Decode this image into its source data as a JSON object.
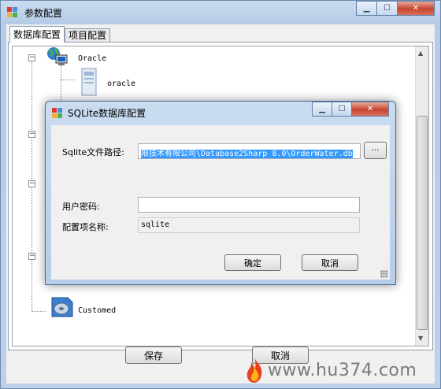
{
  "main_window": {
    "title": "参数配置",
    "tabs": [
      {
        "label": "数据库配置",
        "active": true
      },
      {
        "label": "项目配置",
        "active": false
      }
    ],
    "tree": {
      "nodes": [
        {
          "label": "Oracle",
          "icon": "globe-computer-icon"
        },
        {
          "label": "oracle",
          "icon": "server-icon"
        },
        {
          "label": "Customed",
          "icon": "database-icon"
        }
      ]
    },
    "buttons": {
      "save": "保存",
      "cancel": "取消"
    }
  },
  "dialog": {
    "title": "SQLite数据库配置",
    "fields": {
      "path_label": "Sqlite文件路径:",
      "path_value": "限技术有限公司\\Database2Sharp 8.0\\OrderWater.db",
      "browse_label": "...",
      "password_label": "用户密码:",
      "password_value": "",
      "config_name_label": "配置项名称:",
      "config_name_value": "sqlite"
    },
    "buttons": {
      "ok": "确定",
      "cancel": "取消"
    }
  },
  "watermark": {
    "text": "www.hu374.com"
  },
  "colors": {
    "selection": "#3399ff",
    "close_button": "#c7452e",
    "title_bar": "#b9cde3"
  }
}
